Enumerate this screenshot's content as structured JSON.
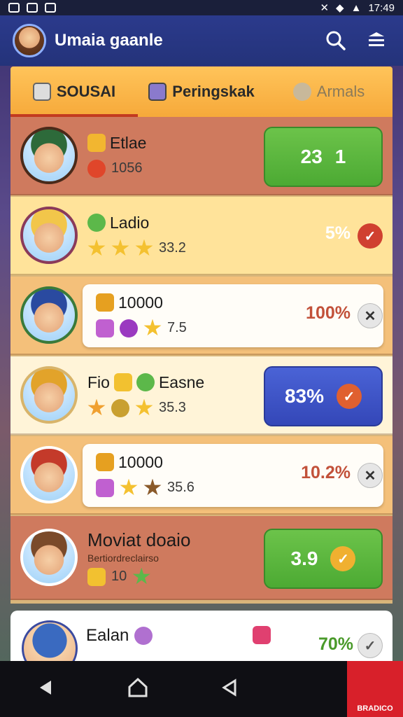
{
  "status_bar": {
    "time": "17:49"
  },
  "header": {
    "title": "Umaia gaanle"
  },
  "tabs": [
    {
      "label": "SOUSAI",
      "active": true
    },
    {
      "label": "Peringskak",
      "active": false
    },
    {
      "label": "Armals",
      "active": false
    }
  ],
  "rows": [
    {
      "name": "Etlae",
      "stat": "1056",
      "action_value": "23",
      "action_value2": "1",
      "style": "green-box",
      "hat": "#2d6a3a",
      "bg": "#cf7a5e"
    },
    {
      "name": "Ladio",
      "stat": "33.2",
      "percent": "5%",
      "pct_color": "#ffffff",
      "icon_state": "check",
      "bg": "#ffe39a",
      "hat": "#f2c64a"
    },
    {
      "name": "10000",
      "stat": "7.5",
      "percent": "100%",
      "pct_color": "#c2513a",
      "icon_state": "x",
      "bg": "#f4c07a",
      "hat": "#2a4aa0"
    },
    {
      "name1": "Fio",
      "name2": "Easne",
      "stat": "35.3",
      "percent": "83%",
      "style": "blue-box",
      "bg": "#fff4d8",
      "hat": "#e2a32a"
    },
    {
      "name": "10000",
      "stat": "35.6",
      "percent": "10.2%",
      "pct_color": "#c2513a",
      "icon_state": "x",
      "bg": "#f4c07a",
      "hat": "#c43a2a"
    },
    {
      "name": "Moviat doaio",
      "subtitle": "Bertiordreclairso",
      "stat": "10",
      "action_value": "3.9",
      "style": "green-box",
      "bg": "#cf7a5e",
      "hat": "#7a4a2a"
    }
  ],
  "bottom_card": {
    "name": "Ealan",
    "percent": "70%"
  },
  "promo": {
    "label": "BRADICO"
  }
}
